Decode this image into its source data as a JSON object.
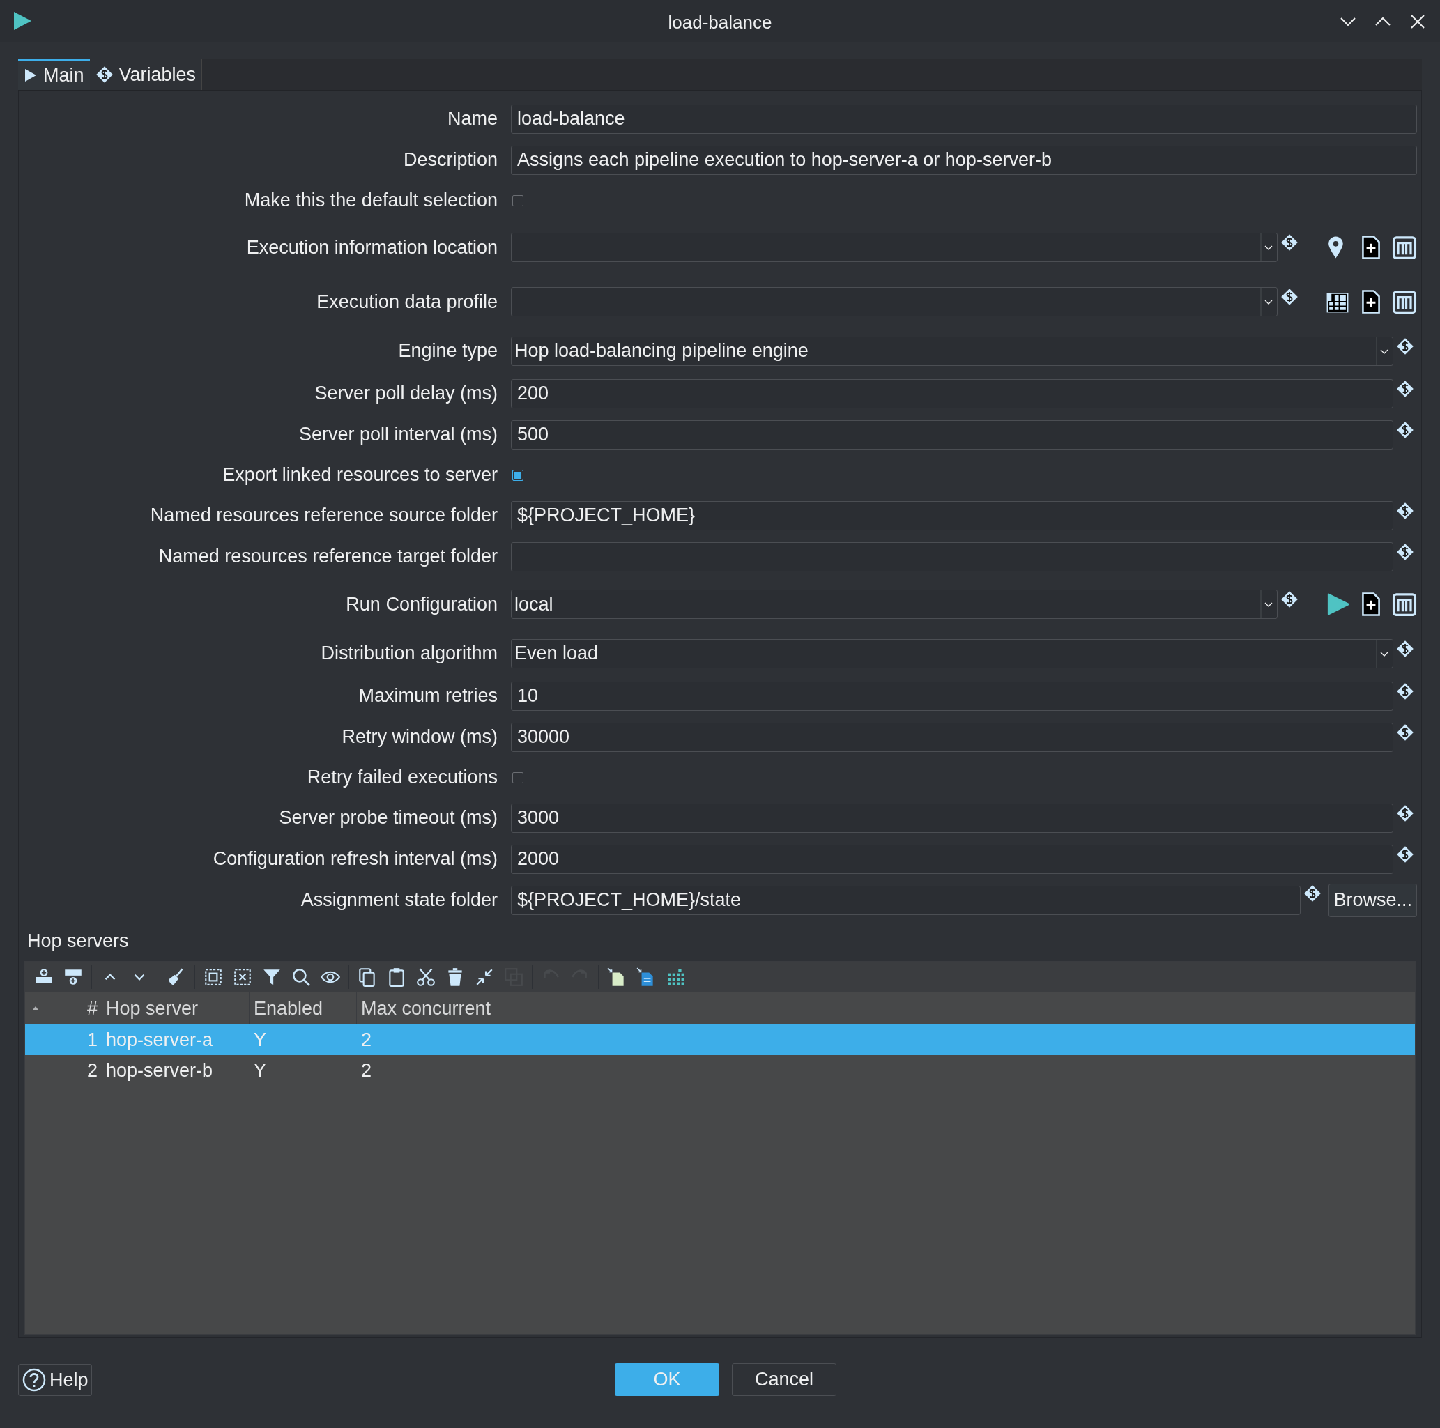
{
  "window": {
    "title": "load-balance"
  },
  "tabs": [
    {
      "label": "Main",
      "kind": "play",
      "selected": true
    },
    {
      "label": "Variables",
      "kind": "variable",
      "selected": false
    }
  ],
  "fields": [
    {
      "kind": "text",
      "label": "Name",
      "value": "load-balance",
      "variable": false
    },
    {
      "kind": "text",
      "label": "Description",
      "value": "Assigns each pipeline execution to hop-server-a or hop-server-b",
      "variable": false
    },
    {
      "kind": "checkbox",
      "label": "Make this the default selection",
      "checked": false
    },
    {
      "kind": "combo",
      "label": "Execution information location",
      "variable": true,
      "actions": [
        {
          "kind": "location"
        },
        {
          "kind": "new"
        },
        {
          "kind": "manage"
        }
      ]
    },
    {
      "kind": "combo",
      "label": "Execution data profile",
      "variable": true,
      "actions": [
        {
          "kind": "grid"
        },
        {
          "kind": "new"
        },
        {
          "kind": "manage"
        }
      ]
    },
    {
      "kind": "combo",
      "label": "Engine type",
      "value": "Hop load-balancing pipeline engine",
      "variable": true
    },
    {
      "kind": "text",
      "label": "Server poll delay (ms)",
      "value": "200",
      "variable": true
    },
    {
      "kind": "text",
      "label": "Server poll interval (ms)",
      "value": "500",
      "variable": true
    },
    {
      "kind": "checkbox",
      "label": "Export linked resources to server",
      "checked": true
    },
    {
      "kind": "text",
      "label": "Named resources reference source folder",
      "value": "${PROJECT_HOME}",
      "variable": true
    },
    {
      "kind": "text",
      "label": "Named resources reference target folder",
      "variable": true
    },
    {
      "kind": "combo",
      "label": "Run Configuration",
      "value": "local",
      "variable": true,
      "actions": [
        {
          "kind": "run"
        },
        {
          "kind": "new"
        },
        {
          "kind": "manage"
        }
      ]
    },
    {
      "kind": "combo",
      "label": "Distribution algorithm",
      "value": "Even load",
      "variable": true
    },
    {
      "kind": "text",
      "label": "Maximum retries",
      "value": "10",
      "variable": true
    },
    {
      "kind": "text",
      "label": "Retry window (ms)",
      "value": "30000",
      "variable": true
    },
    {
      "kind": "checkbox",
      "label": "Retry failed executions",
      "checked": false
    },
    {
      "kind": "text",
      "label": "Server probe timeout (ms)",
      "value": "3000",
      "variable": true
    },
    {
      "kind": "text",
      "label": "Configuration refresh interval (ms)",
      "value": "2000",
      "variable": true
    },
    {
      "kind": "text",
      "label": "Assignment state folder",
      "value": "${PROJECT_HOME}/state",
      "variable": true,
      "button": "Browse..."
    }
  ],
  "servers": {
    "title": "Hop servers",
    "toolbar": [
      [
        {
          "kind": "insert-before",
          "disabled": false
        },
        {
          "kind": "insert-after",
          "disabled": false
        }
      ],
      [
        {
          "kind": "up",
          "disabled": false
        },
        {
          "kind": "down",
          "disabled": false
        }
      ],
      [
        {
          "kind": "clear",
          "disabled": false
        }
      ],
      [
        {
          "kind": "select-all",
          "disabled": false
        },
        {
          "kind": "deselect",
          "disabled": false
        },
        {
          "kind": "filter",
          "disabled": false
        },
        {
          "kind": "search",
          "disabled": false
        },
        {
          "kind": "eye",
          "disabled": false
        }
      ],
      [
        {
          "kind": "copy",
          "disabled": false
        },
        {
          "kind": "paste",
          "disabled": false
        },
        {
          "kind": "cut",
          "disabled": false
        },
        {
          "kind": "delete",
          "disabled": false
        },
        {
          "kind": "shrink",
          "disabled": false
        },
        {
          "kind": "duplicate",
          "disabled": true
        }
      ],
      [
        {
          "kind": "undo",
          "disabled": true
        },
        {
          "kind": "redo",
          "disabled": true
        }
      ],
      [
        {
          "kind": "import-sheet",
          "disabled": false
        },
        {
          "kind": "import-doc",
          "disabled": false
        },
        {
          "kind": "grid",
          "disabled": false
        }
      ]
    ],
    "columns": [
      "#",
      "Hop server",
      "Enabled",
      "Max concurrent"
    ],
    "rows": [
      {
        "cells": [
          "1",
          "hop-server-a",
          "Y",
          "2"
        ],
        "selected": true
      },
      {
        "cells": [
          "2",
          "hop-server-b",
          "Y",
          "2"
        ],
        "selected": false
      }
    ]
  },
  "buttons": {
    "help": "Help",
    "ok": "OK",
    "cancel": "Cancel"
  }
}
